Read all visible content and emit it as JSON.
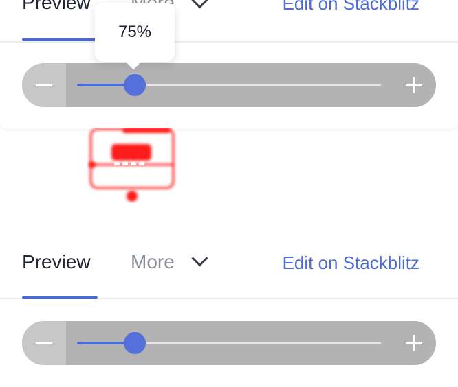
{
  "top": {
    "tabs": {
      "preview_label": "Preview",
      "more_label": "More",
      "edit_label": "Edit on Stackblitz"
    },
    "zoom": {
      "tooltip": "75%",
      "progress": 0.19
    }
  },
  "bottom": {
    "tabs": {
      "preview_label": "Preview",
      "more_label": "More",
      "edit_label": "Edit on Stackblitz"
    },
    "zoom": {
      "progress": 0.19
    }
  },
  "colors": {
    "accent": "#4b6bd6",
    "zoom_bar": "#b3b3b3",
    "broken_image": "#ff0000"
  }
}
